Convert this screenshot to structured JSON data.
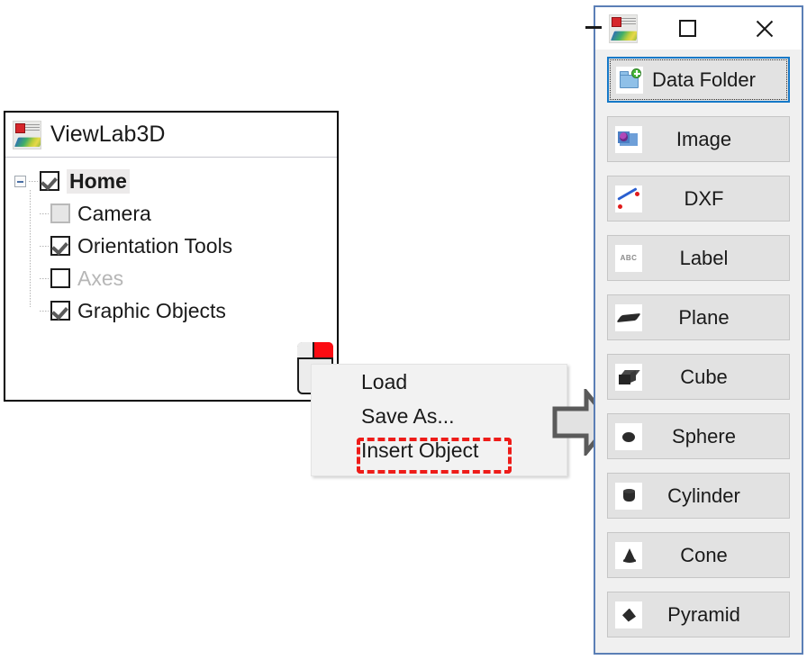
{
  "tree_panel": {
    "app_title": "ViewLab3D",
    "app_icon": "viewlab3d-logo-icon",
    "nodes": [
      {
        "label": "Home",
        "checked": true,
        "enabled": true,
        "bold": true,
        "level": 0,
        "expander": "collapse-minus-icon"
      },
      {
        "label": "Camera",
        "checked": false,
        "enabled": false,
        "bold": false,
        "level": 1
      },
      {
        "label": "Orientation Tools",
        "checked": true,
        "enabled": true,
        "bold": false,
        "level": 1
      },
      {
        "label": "Axes",
        "checked": false,
        "enabled": false,
        "bold": false,
        "level": 1,
        "dim_text": true
      },
      {
        "label": "Graphic Objects",
        "checked": true,
        "enabled": true,
        "bold": false,
        "level": 1
      }
    ]
  },
  "mouse_hint": {
    "icon": "mouse-right-click-icon",
    "highlight_color": "#fb0b12"
  },
  "context_menu": {
    "items": [
      {
        "label": "Load",
        "highlighted": false
      },
      {
        "label": "Save As...",
        "highlighted": false
      },
      {
        "label": "Insert Object",
        "highlighted": true
      }
    ],
    "highlight_color": "#ee1c19"
  },
  "flow_arrow": {
    "icon": "right-block-arrow-icon",
    "fill": "#e0e0e0",
    "stroke": "#5a5a5a"
  },
  "object_window": {
    "titlebar": {
      "app_icon": "viewlab3d-logo-icon",
      "minimize_label": "minimize-icon",
      "maximize_label": "maximize-icon",
      "close_label": "close-icon"
    },
    "accent_color": "#1579c8",
    "border_color": "#5b7fb6",
    "buttons": [
      {
        "label": "Data Folder",
        "icon": "new-folder-icon",
        "focused": true
      },
      {
        "label": "Image",
        "icon": "image-icon",
        "focused": false
      },
      {
        "label": "DXF",
        "icon": "dxf-line-icon",
        "focused": false
      },
      {
        "label": "Label",
        "icon": "abc-label-icon",
        "focused": false
      },
      {
        "label": "Plane",
        "icon": "plane-icon",
        "focused": false
      },
      {
        "label": "Cube",
        "icon": "cube-icon",
        "focused": false
      },
      {
        "label": "Sphere",
        "icon": "sphere-icon",
        "focused": false
      },
      {
        "label": "Cylinder",
        "icon": "cylinder-icon",
        "focused": false
      },
      {
        "label": "Cone",
        "icon": "cone-icon",
        "focused": false
      },
      {
        "label": "Pyramid",
        "icon": "pyramid-icon",
        "focused": false
      }
    ]
  }
}
